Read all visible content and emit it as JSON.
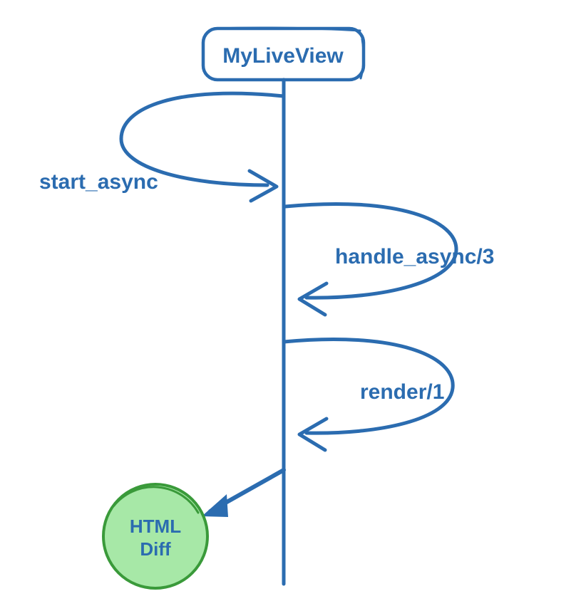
{
  "colors": {
    "stroke": "#2b6cb0",
    "circleFill": "#a7e8a7",
    "circleStroke": "#3a9a3a"
  },
  "box": {
    "title": "MyLiveView"
  },
  "labels": {
    "start_async": "start_async",
    "handle_async": "handle_async/3",
    "render": "render/1"
  },
  "circle": {
    "line1": "HTML",
    "line2": "Diff"
  }
}
